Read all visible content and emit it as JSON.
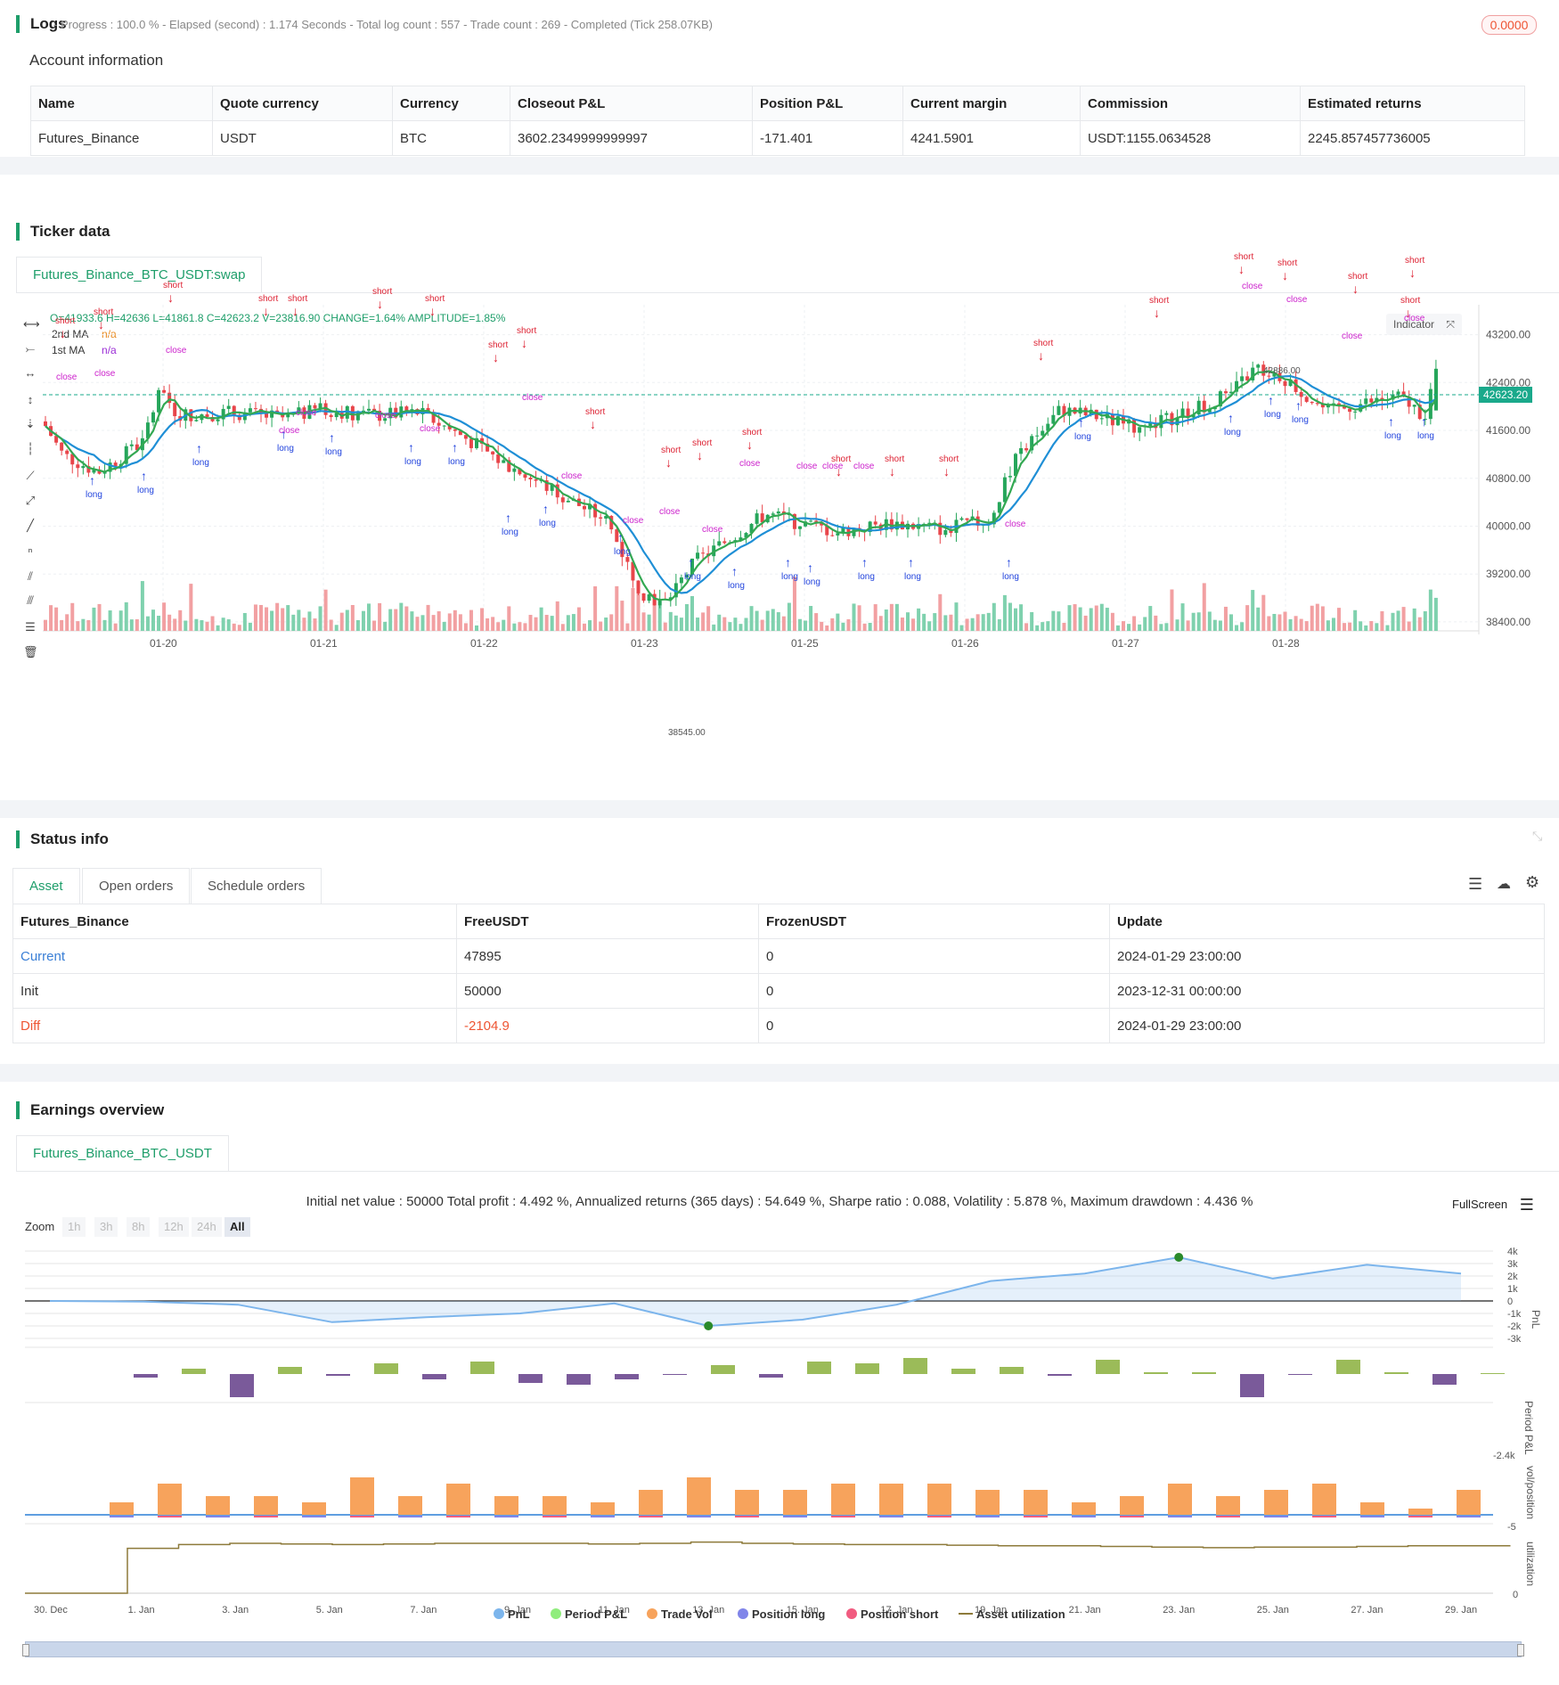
{
  "logs": {
    "title": "Logs",
    "status": "- Progress : 100.0 % - Elapsed (second) : 1.174  Seconds - Total log count : 557 - Trade count : 269 - Completed (Tick 258.07KB)",
    "badge": "0.0000"
  },
  "account": {
    "title": "Account information",
    "headers": [
      "Name",
      "Quote currency",
      "Currency",
      "Closeout P&L",
      "Position P&L",
      "Current margin",
      "Commission",
      "Estimated returns"
    ],
    "row": [
      "Futures_Binance",
      "USDT",
      "BTC",
      "3602.2349999999997",
      "-171.401",
      "4241.5901",
      "USDT:1155.0634528",
      "2245.857457736005"
    ]
  },
  "ticker": {
    "title": "Ticker data",
    "tab": "Futures_Binance_BTC_USDT:swap",
    "ohlc": "O=41933.6 H=42636 L=41861.8 C=42623.2 V=23816.90 CHANGE=1.64% AMPLITUDE=1.85%",
    "ma2_label": "2nd MA",
    "ma2_value": "n/a",
    "ma1_label": "1st MA",
    "ma1_value": "n/a",
    "indicator_btn": "Indicator",
    "price_tag": "42623.20",
    "high_marker": "42886.00",
    "low_marker": "38545.00",
    "y_ticks": [
      "43200.00",
      "42400.00",
      "41600.00",
      "40800.00",
      "40000.00",
      "39200.00",
      "38400.00"
    ],
    "x_ticks": [
      "01-20",
      "01-21",
      "01-22",
      "01-23",
      "01-25",
      "01-26",
      "01-27",
      "01-28"
    ],
    "colors": {
      "up": "#26a65b",
      "down": "#e8454a",
      "ma1": "#1f8fd6",
      "ma2": "#33a852",
      "long": "#2244dd",
      "short": "#dd2233",
      "close": "#cc22cc"
    }
  },
  "status": {
    "title": "Status info",
    "tabs": [
      "Asset",
      "Open orders",
      "Schedule orders"
    ],
    "headers": [
      "Futures_Binance",
      "FreeUSDT",
      "FrozenUSDT",
      "Update"
    ],
    "rows": [
      [
        "Current",
        "47895",
        "0",
        "2024-01-29 23:00:00"
      ],
      [
        "Init",
        "50000",
        "0",
        "2023-12-31 00:00:00"
      ],
      [
        "Diff",
        "-2104.9",
        "0",
        "2024-01-29 23:00:00"
      ]
    ]
  },
  "earnings": {
    "title": "Earnings overview",
    "tab": "Futures_Binance_BTC_USDT",
    "summary": "Initial net value : 50000 Total profit : 4.492 %, Annualized returns (365 days) : 54.649 %, Sharpe ratio : 0.088, Volatility : 5.878 %, Maximum drawdown : 4.436 %",
    "fullscreen": "FullScreen",
    "zoom_label": "Zoom",
    "zoom_options": [
      "1h",
      "3h",
      "8h",
      "12h",
      "24h",
      "All"
    ],
    "pnl_ticks": [
      "4k",
      "3k",
      "2k",
      "1k",
      "0",
      "-1k",
      "-2k",
      "-3k"
    ],
    "pnl_label": "PnL",
    "period_label": "Period P&L",
    "period_tick": "-2.4k",
    "vol_label": "vol/position",
    "vol_tick": "-5",
    "util_label": "utilization",
    "util_tick": "0",
    "x_ticks": [
      "30. Dec",
      "1. Jan",
      "3. Jan",
      "5. Jan",
      "7. Jan",
      "9. Jan",
      "11. Jan",
      "13. Jan",
      "15. Jan",
      "17. Jan",
      "19. Jan",
      "21. Jan",
      "23. Jan",
      "25. Jan",
      "27. Jan",
      "29. Jan"
    ],
    "legend": [
      "PnL",
      "Period P&L",
      "Trade Vol",
      "Position long",
      "Position short",
      "Asset utilization"
    ],
    "legend_colors": [
      "#7cb5ec",
      "#90ed7d",
      "#f7a35c",
      "#8085e9",
      "#f15c80",
      "#8d7a3a"
    ]
  },
  "chart_data": {
    "type": "line",
    "title": "",
    "x": [
      "30. Dec",
      "1. Jan",
      "3. Jan",
      "5. Jan",
      "7. Jan",
      "9. Jan",
      "11. Jan",
      "13. Jan",
      "15. Jan",
      "17. Jan",
      "19. Jan",
      "21. Jan",
      "23. Jan",
      "25. Jan",
      "27. Jan",
      "29. Jan"
    ],
    "series": [
      {
        "name": "PnL",
        "values": [
          0,
          -50,
          -300,
          -1700,
          -1300,
          -1000,
          -200,
          -2000,
          -1500,
          -300,
          1600,
          2200,
          3500,
          1800,
          2900,
          2200
        ]
      }
    ],
    "period_pnl": [
      -200,
      300,
      -1300,
      400,
      -100,
      600,
      -300,
      700,
      -500,
      -600,
      -300,
      -50,
      500,
      -200,
      700,
      600,
      900,
      300,
      400,
      -100,
      800,
      100,
      100,
      -1300,
      -50,
      800,
      100,
      -600,
      50
    ],
    "trade_vol": [
      2,
      5,
      3,
      3,
      2,
      6,
      3,
      5,
      3,
      3,
      2,
      4,
      6,
      4,
      4,
      5,
      5,
      5,
      4,
      4,
      2,
      3,
      5,
      3,
      4,
      5,
      2,
      1,
      4
    ],
    "utilization": [
      0,
      0,
      0.72,
      0.78,
      0.8,
      0.79,
      0.78,
      0.79,
      0.8,
      0.8,
      0.8,
      0.79,
      0.8,
      0.82,
      0.8,
      0.79,
      0.78,
      0.78,
      0.77,
      0.76,
      0.76,
      0.75,
      0.74,
      0.73,
      0.74,
      0.74,
      0.75,
      0.76,
      0.76
    ],
    "ylim": [
      -3000,
      4000
    ]
  }
}
